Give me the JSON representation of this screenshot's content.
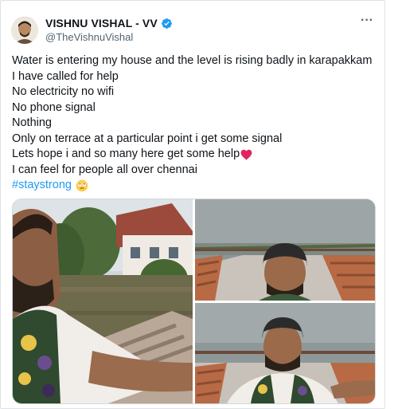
{
  "author": {
    "display_name": "VISHNU VISHAL - VV",
    "handle": "@TheVishnuVishal",
    "avatar_icon": "profile-photo",
    "verified_icon": "verified-badge-icon",
    "verified_color": "#1d9bf0"
  },
  "more_label": "···",
  "tweet": {
    "lines": [
      "Water is entering my house and the level is rising badly in karapakkam",
      "I have called for help",
      "No electricity no wifi",
      "No phone signal",
      "Nothing",
      "Only on terrace at a particular point i get some signal",
      "Lets hope i and so many here get some help",
      "I can feel for people all over chennai"
    ],
    "hashtag": "#staystrong",
    "heart_icon": "red-heart-emoji",
    "face_icon": "face-with-rolling-eyes-emoji"
  },
  "media": {
    "count": 3,
    "items": [
      "flooded-street-selfie-photo",
      "terrace-selfie-photo-1",
      "terrace-selfie-photo-2"
    ]
  },
  "colors": {
    "text": "#0f1419",
    "secondary": "#536471",
    "link": "#1d9bf0",
    "heart": "#e0245e"
  }
}
